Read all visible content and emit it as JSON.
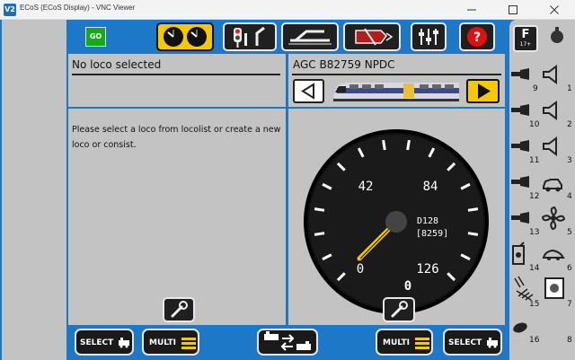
{
  "window": {
    "title": "ECoS (ECoS Display) - VNC Viewer",
    "app_icon": "V2"
  },
  "toolbar": {
    "go_label": "GO",
    "go_color": "#18a818",
    "accent_yellow": "#f5c800",
    "help_color": "#e01010"
  },
  "left_panel": {
    "title": "No loco selected",
    "message": "Please select a loco from locolist or create a new loco or consist."
  },
  "right_panel": {
    "loco_name": "AGC B82759 NPDC"
  },
  "speedometer": {
    "tick_labels": [
      "0",
      "42",
      "84",
      "126"
    ],
    "speed_value": "0",
    "loco_id": "D128",
    "loco_address": "[8259]",
    "max_speed": 126,
    "current_speed": 0
  },
  "bottom_bar": {
    "select_left": "SELECT",
    "multi_left": "MULTI",
    "multi_right": "MULTI",
    "select_right": "SELECT"
  },
  "functions": {
    "f_button_label": "F",
    "f_button_sub": "17+",
    "numbers": [
      "9",
      "1",
      "10",
      "2",
      "11",
      "3",
      "12",
      "4",
      "13",
      "5",
      "14",
      "6",
      "15",
      "7",
      "16",
      "8"
    ]
  }
}
